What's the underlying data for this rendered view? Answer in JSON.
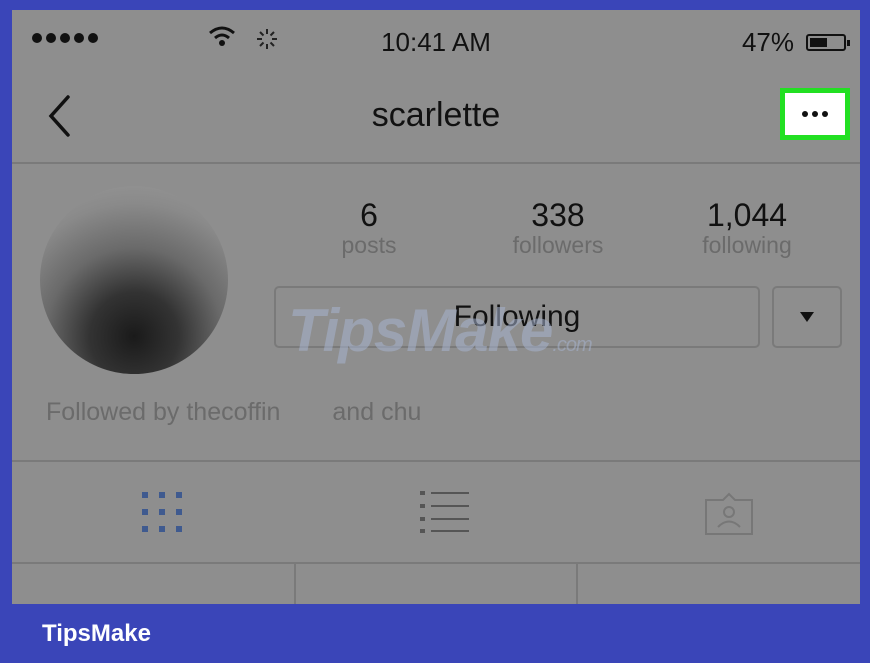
{
  "status_bar": {
    "time": "10:41 AM",
    "battery": "47%"
  },
  "nav": {
    "title": "scarlette"
  },
  "profile": {
    "stats": [
      {
        "value": "6",
        "label": "posts"
      },
      {
        "value": "338",
        "label": "followers"
      },
      {
        "value": "1,044",
        "label": "following"
      }
    ],
    "following_button": "Following",
    "followed_by": {
      "part1": "Followed by thecoffin",
      "part2": "and chu"
    }
  },
  "watermark": {
    "brand": "TipsMake",
    "suffix": ".com"
  },
  "footer": {
    "brand": "TipsMake"
  },
  "colors": {
    "frame": "#3a45b8",
    "highlight": "#22e022",
    "screen_dim": "#8e8e8e",
    "tab_active": "#3f5a8f"
  },
  "icons": [
    "back-chevron-icon",
    "more-dots-icon",
    "dropdown-caret-icon",
    "grid-view-icon",
    "list-view-icon",
    "tagged-photos-icon",
    "wifi-icon",
    "spinner-icon",
    "battery-icon"
  ]
}
